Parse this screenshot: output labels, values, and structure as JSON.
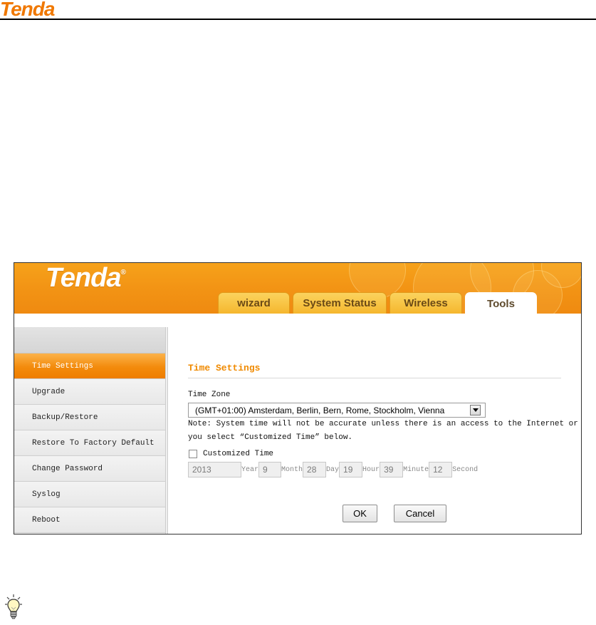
{
  "document": {
    "logo": "Tenda"
  },
  "banner": {
    "logo": "Tenda",
    "logo_mark": "®"
  },
  "tabs": [
    {
      "label": "wizard",
      "active": false
    },
    {
      "label": "System Status",
      "active": false
    },
    {
      "label": "Wireless",
      "active": false
    },
    {
      "label": "Tools",
      "active": true
    }
  ],
  "sidebar": {
    "items": [
      {
        "label": "Time Settings",
        "active": true
      },
      {
        "label": "Upgrade",
        "active": false
      },
      {
        "label": "Backup/Restore",
        "active": false
      },
      {
        "label": "Restore To Factory Default",
        "active": false
      },
      {
        "label": "Change Password",
        "active": false
      },
      {
        "label": "Syslog",
        "active": false
      },
      {
        "label": "Reboot",
        "active": false
      }
    ]
  },
  "main": {
    "title": "Time Settings",
    "time_zone_label": "Time Zone",
    "time_zone_value": "(GMT+01:00) Amsterdam, Berlin, Bern, Rome, Stockholm, Vienna",
    "note_line1": "Note: System time will not be accurate unless there is an access to the Internet or",
    "note_line2": "you select “Customized Time” below.",
    "customized_time_label": "Customized Time",
    "customized_time_checked": false,
    "time_fields": {
      "year_value": "2013",
      "year_label": "Year",
      "month_value": "9",
      "month_label": "Month",
      "day_value": "28",
      "day_label": "Day",
      "hour_value": "19",
      "hour_label": "Hour",
      "minute_value": "39",
      "minute_label": "Minute",
      "second_value": "12",
      "second_label": "Second"
    },
    "ok_label": "OK",
    "cancel_label": "Cancel"
  },
  "icons": {
    "dropdown": "chevron-down-icon",
    "tip": "lightbulb-icon"
  },
  "colors": {
    "brand_orange": "#f08a00",
    "banner_orange": "#f39515",
    "tab_gold": "#f5b72e",
    "active_menu": "#f38b0c"
  }
}
